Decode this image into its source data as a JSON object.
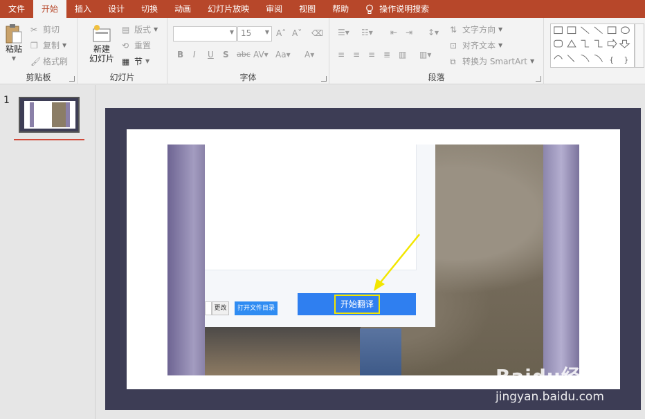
{
  "tabs": [
    {
      "label": "文件"
    },
    {
      "label": "开始"
    },
    {
      "label": "插入"
    },
    {
      "label": "设计"
    },
    {
      "label": "切换"
    },
    {
      "label": "动画"
    },
    {
      "label": "幻灯片放映"
    },
    {
      "label": "审阅"
    },
    {
      "label": "视图"
    },
    {
      "label": "帮助"
    },
    {
      "label": "操作说明搜索"
    }
  ],
  "ribbon": {
    "clipboard": {
      "label": "剪贴板",
      "paste": "粘贴",
      "cut": "剪切",
      "copy": "复制",
      "format_painter": "格式刷"
    },
    "slides": {
      "label": "幻灯片",
      "new_slide_line1": "新建",
      "new_slide_line2": "幻灯片",
      "layout": "版式",
      "reset": "重置",
      "section": "节"
    },
    "font": {
      "label": "字体",
      "font_name": "",
      "font_size": "15"
    },
    "paragraph": {
      "label": "段落",
      "text_direction": "文字方向",
      "align_text": "对齐文本",
      "convert_smartart": "转换为 SmartArt"
    }
  },
  "thumbnails": {
    "slide_number": "1"
  },
  "slide": {
    "dialog": {
      "change_button": "更改",
      "open_folder_button": "打开文件目录",
      "start_translate_button": "开始翻译"
    }
  },
  "watermark": {
    "brand": "Baidu经验",
    "url": "jingyan.baidu.com"
  },
  "colors": {
    "accent": "#b7472a",
    "blue_button": "#2f7ff0",
    "highlight": "#f2e600",
    "slide_frame": "#3d3d55"
  }
}
